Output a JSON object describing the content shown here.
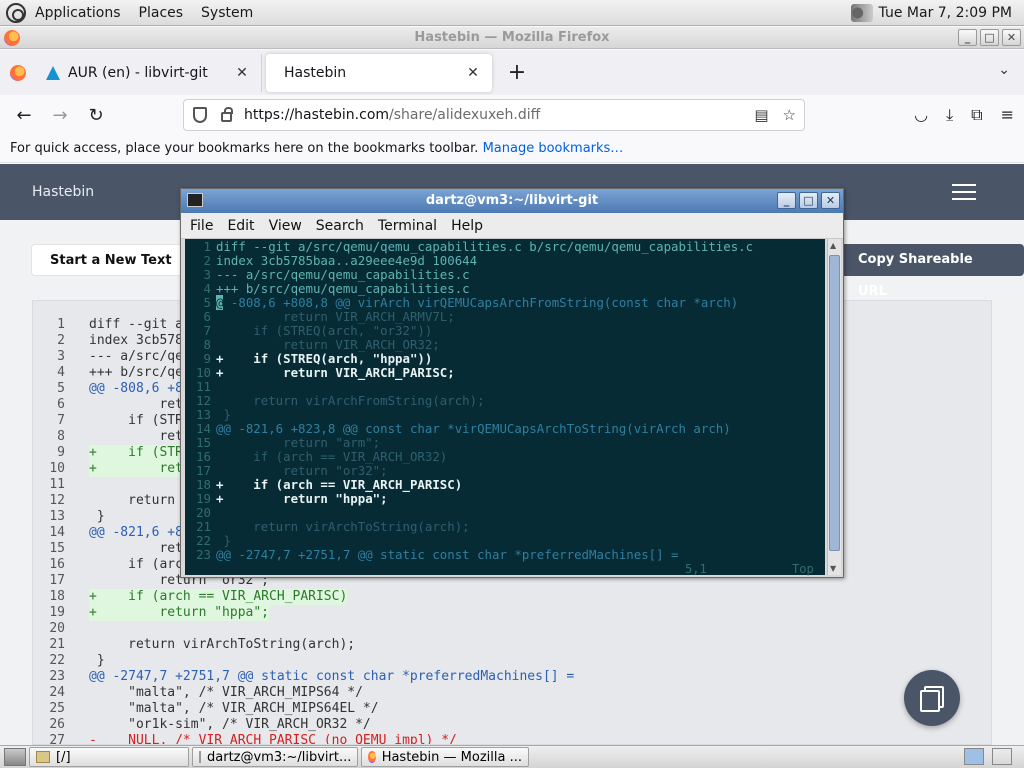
{
  "top_panel": {
    "menus": [
      "Applications",
      "Places",
      "System"
    ],
    "clock": "Tue Mar  7,  2:09 PM"
  },
  "firefox": {
    "window_title": "Hastebin — Mozilla Firefox",
    "tabs": [
      {
        "title": "AUR (en) - libvirt-git",
        "icon": "arch-linux-icon"
      },
      {
        "title": "Hastebin",
        "icon": "none"
      }
    ],
    "url": {
      "domain": "https://hastebin.com",
      "path": "/share/alidexuxeh.diff"
    },
    "bookmarks_text": "For quick access, place your bookmarks here on the bookmarks toolbar.",
    "bookmarks_link": "Manage bookmarks…"
  },
  "hastebin": {
    "brand": "Hastebin",
    "new_text_label": "Start a New Text",
    "copy_url_label": "Copy Shareable URL",
    "lines": [
      {
        "n": "1",
        "t": "diff --git a",
        "k": "plain"
      },
      {
        "n": "2",
        "t": "index 3cb578",
        "k": "plain"
      },
      {
        "n": "3",
        "t": "--- a/src/qe",
        "k": "plain"
      },
      {
        "n": "4",
        "t": "+++ b/src/qe",
        "k": "plain"
      },
      {
        "n": "5",
        "t": "@@ -808,6 +8",
        "k": "hl"
      },
      {
        "n": "6",
        "t": "         ret",
        "k": "plain"
      },
      {
        "n": "7",
        "t": "     if (STR",
        "k": "plain"
      },
      {
        "n": "8",
        "t": "         ret",
        "k": "plain"
      },
      {
        "n": "9",
        "t": "+    if (STR",
        "k": "add"
      },
      {
        "n": "10",
        "t": "+        ret",
        "k": "add"
      },
      {
        "n": "11",
        "t": "",
        "k": "plain"
      },
      {
        "n": "12",
        "t": "     return",
        "k": "plain"
      },
      {
        "n": "13",
        "t": " }",
        "k": "plain"
      },
      {
        "n": "14",
        "t": "@@ -821,6 +8",
        "k": "hl"
      },
      {
        "n": "15",
        "t": "         ret",
        "k": "plain"
      },
      {
        "n": "16",
        "t": "     if (arc",
        "k": "plain"
      },
      {
        "n": "17",
        "t": "         return \"or32\";",
        "k": "plain"
      },
      {
        "n": "18",
        "t": "+    if (arch == VIR_ARCH_PARISC)",
        "k": "add"
      },
      {
        "n": "19",
        "t": "+        return \"hppa\";",
        "k": "add"
      },
      {
        "n": "20",
        "t": "",
        "k": "plain"
      },
      {
        "n": "21",
        "t": "     return virArchToString(arch);",
        "k": "plain"
      },
      {
        "n": "22",
        "t": " }",
        "k": "plain"
      },
      {
        "n": "23",
        "t": "@@ -2747,7 +2751,7 @@ static const char *preferredMachines[] =",
        "k": "hl"
      },
      {
        "n": "24",
        "t": "     \"malta\", /* VIR_ARCH_MIPS64 */",
        "k": "plain"
      },
      {
        "n": "25",
        "t": "     \"malta\", /* VIR_ARCH_MIPS64EL */",
        "k": "plain"
      },
      {
        "n": "26",
        "t": "     \"or1k-sim\", /* VIR_ARCH_OR32 */",
        "k": "plain"
      },
      {
        "n": "27",
        "t": "-    NULL, /* VIR_ARCH_PARISC (no QEMU impl) */",
        "k": "del"
      }
    ]
  },
  "terminal": {
    "title": "dartz@vm3:~/libvirt-git",
    "menu": [
      "File",
      "Edit",
      "View",
      "Search",
      "Terminal",
      "Help"
    ],
    "lines": [
      {
        "n": "1",
        "t": "diff --git a/src/qemu/qemu_capabilities.c b/src/qemu/qemu_capabilities.c",
        "k": "hd"
      },
      {
        "n": "2",
        "t": "index 3cb5785baa..a29eee4e9d 100644",
        "k": "hd"
      },
      {
        "n": "3",
        "t": "--- a/src/qemu/qemu_capabilities.c",
        "k": "hd"
      },
      {
        "n": "4",
        "t": "+++ b/src/qemu/qemu_capabilities.c",
        "k": "hd"
      },
      {
        "n": "5",
        "t": " -808,6 +808,8 @@ virArch virQEMUCapsArchFromString(const char *arch)",
        "k": "hk"
      },
      {
        "n": "6",
        "t": "         return VIR_ARCH_ARMV7L;",
        "k": "ctx"
      },
      {
        "n": "7",
        "t": "     if (STREQ(arch, \"or32\"))",
        "k": "ctx"
      },
      {
        "n": "8",
        "t": "         return VIR_ARCH_OR32;",
        "k": "ctx"
      },
      {
        "n": "9",
        "t": "+    if (STREQ(arch, \"hppa\"))",
        "k": "ad"
      },
      {
        "n": "10",
        "t": "+        return VIR_ARCH_PARISC;",
        "k": "ad"
      },
      {
        "n": "11",
        "t": "",
        "k": "ctx"
      },
      {
        "n": "12",
        "t": "     return virArchFromString(arch);",
        "k": "ctx"
      },
      {
        "n": "13",
        "t": " }",
        "k": "ctx"
      },
      {
        "n": "14",
        "t": "@@ -821,6 +823,8 @@ const char *virQEMUCapsArchToString(virArch arch)",
        "k": "hk"
      },
      {
        "n": "15",
        "t": "         return \"arm\";",
        "k": "ctx"
      },
      {
        "n": "16",
        "t": "     if (arch == VIR_ARCH_OR32)",
        "k": "ctx"
      },
      {
        "n": "17",
        "t": "         return \"or32\";",
        "k": "ctx"
      },
      {
        "n": "18",
        "t": "+    if (arch == VIR_ARCH_PARISC)",
        "k": "ad"
      },
      {
        "n": "19",
        "t": "+        return \"hppa\";",
        "k": "ad"
      },
      {
        "n": "20",
        "t": "",
        "k": "ctx"
      },
      {
        "n": "21",
        "t": "     return virArchToString(arch);",
        "k": "ctx"
      },
      {
        "n": "22",
        "t": " }",
        "k": "ctx"
      },
      {
        "n": "23",
        "t": "@@ -2747,7 +2751,7 @@ static const char *preferredMachines[] =",
        "k": "hk"
      }
    ],
    "cursor_char": "@",
    "status_pos": "5,1",
    "status_scroll": "Top"
  },
  "taskbar": {
    "tasks": [
      {
        "label": "[/]",
        "icon": "folder-icon"
      },
      {
        "label": "dartz@vm3:~/libvirt...",
        "icon": "terminal-icon"
      },
      {
        "label": "Hastebin — Mozilla ...",
        "icon": "firefox-icon"
      }
    ]
  },
  "colors": {
    "hastebin_header": "#4a5568",
    "terminal_bg": "#062b35",
    "titlebar_active": "#4d79b3"
  }
}
